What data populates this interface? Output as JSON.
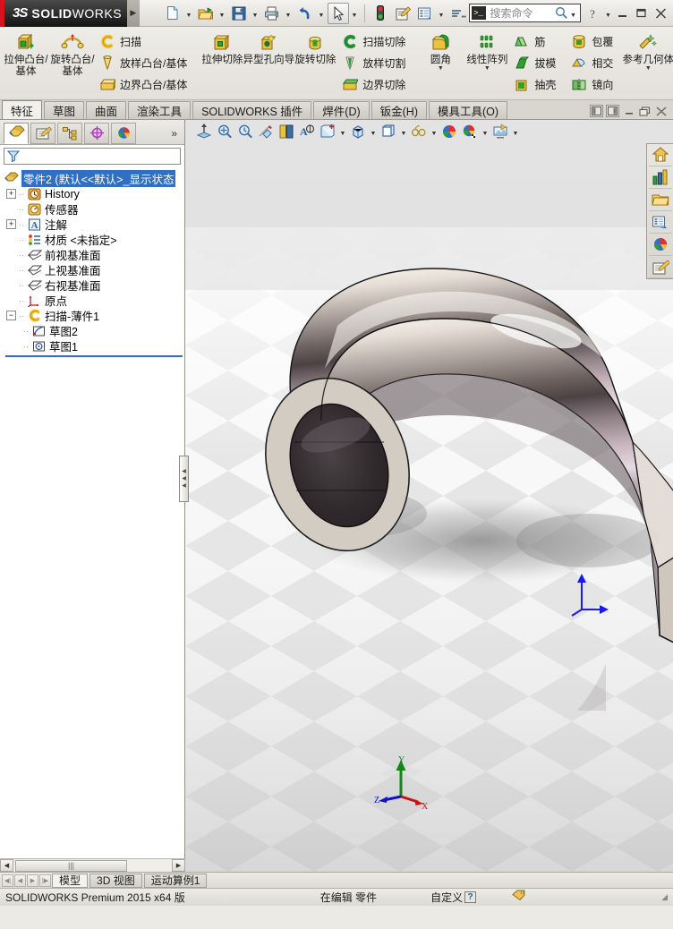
{
  "app": {
    "brand_ds": "3S",
    "brand_solid": "SOLID",
    "brand_works": "WORKS",
    "brand_red": "#d8121c"
  },
  "titlebar": {
    "tools": [
      {
        "name": "new-document",
        "label": "新建"
      },
      {
        "name": "open-document",
        "label": "打开"
      },
      {
        "name": "save-document",
        "label": "保存"
      },
      {
        "name": "print-document",
        "label": "打印"
      },
      {
        "name": "undo",
        "label": "撤消"
      },
      {
        "name": "select",
        "label": "选择"
      },
      {
        "name": "rebuild",
        "label": "重建模型"
      },
      {
        "name": "file-properties",
        "label": "文件属性"
      },
      {
        "name": "options",
        "label": "选项"
      },
      {
        "name": "toolbar-overflow",
        "label": "更多"
      }
    ],
    "search_placeholder": "搜索命令",
    "help_label": "帮助",
    "minimize_label": "最小化",
    "restore_label": "还原",
    "close_label": "关闭"
  },
  "ribbon": {
    "groups": [
      {
        "big": [
          {
            "label": "拉伸凸台/基体",
            "name": "extruded-boss-base",
            "dropdown": false
          },
          {
            "label": "旋转凸台/基体",
            "name": "revolved-boss-base",
            "dropdown": false
          }
        ],
        "small": [
          {
            "label": "扫描",
            "name": "swept-boss-base"
          },
          {
            "label": "放样凸台/基体",
            "name": "lofted-boss-base"
          },
          {
            "label": "边界凸台/基体",
            "name": "boundary-boss-base"
          }
        ]
      },
      {
        "big": [
          {
            "label": "拉伸切除",
            "name": "extruded-cut",
            "dropdown": false
          },
          {
            "label": "异型孔向导",
            "name": "hole-wizard",
            "dropdown": false
          },
          {
            "label": "旋转切除",
            "name": "revolved-cut",
            "dropdown": false
          }
        ],
        "small": [
          {
            "label": "扫描切除",
            "name": "swept-cut"
          },
          {
            "label": "放样切割",
            "name": "lofted-cut"
          },
          {
            "label": "边界切除",
            "name": "boundary-cut"
          }
        ]
      },
      {
        "big": [
          {
            "label": "圆角",
            "name": "fillet",
            "dropdown": true
          },
          {
            "label": "线性阵列",
            "name": "linear-pattern",
            "dropdown": true
          }
        ],
        "small": [
          {
            "label": "筋",
            "name": "rib"
          },
          {
            "label": "拔模",
            "name": "draft"
          },
          {
            "label": "抽壳",
            "name": "shell"
          }
        ]
      },
      {
        "big": [],
        "small": [
          {
            "label": "包覆",
            "name": "wrap"
          },
          {
            "label": "相交",
            "name": "intersect"
          },
          {
            "label": "镜向",
            "name": "mirror"
          }
        ]
      },
      {
        "big": [
          {
            "label": "参考几何体",
            "name": "reference-geometry",
            "dropdown": true
          }
        ],
        "small": []
      }
    ],
    "overflow": "»"
  },
  "tabs": {
    "items": [
      {
        "label": "特征",
        "name": "tab-features",
        "active": true
      },
      {
        "label": "草图",
        "name": "tab-sketch",
        "active": false
      },
      {
        "label": "曲面",
        "name": "tab-surfaces",
        "active": false
      },
      {
        "label": "渲染工具",
        "name": "tab-render-tools",
        "active": false
      },
      {
        "label": "SOLIDWORKS 插件",
        "name": "tab-solidworks-addins",
        "active": false
      },
      {
        "label": "焊件(D)",
        "name": "tab-weldments",
        "active": false
      },
      {
        "label": "钣金(H)",
        "name": "tab-sheet-metal",
        "active": false
      },
      {
        "label": "模具工具(O)",
        "name": "tab-mold-tools",
        "active": false
      }
    ],
    "doc_controls": [
      {
        "name": "collapse-left-panel",
        "glyph": "◧"
      },
      {
        "name": "collapse-right-panel",
        "glyph": "◨"
      },
      {
        "name": "doc-minimize",
        "glyph": "—"
      },
      {
        "name": "doc-restore",
        "glyph": "❐"
      },
      {
        "name": "doc-close",
        "glyph": "✕"
      }
    ]
  },
  "feature_manager": {
    "panel_tabs": [
      {
        "name": "feature-manager-tab",
        "active": true
      },
      {
        "name": "property-manager-tab",
        "active": false
      },
      {
        "name": "configuration-manager-tab",
        "active": false
      },
      {
        "name": "dimxpert-manager-tab",
        "active": false
      },
      {
        "name": "display-manager-tab",
        "active": false
      }
    ],
    "overflow": "»",
    "filter_placeholder": "",
    "tree": [
      {
        "label": "零件2  (默认<<默认>_显示状态",
        "name": "tree-part-root",
        "icon": "part-icon",
        "level": 0,
        "expand": "",
        "selected": true
      },
      {
        "label": "History",
        "name": "tree-history",
        "icon": "history-icon",
        "level": 1,
        "expand": "+",
        "selected": false
      },
      {
        "label": "传感器",
        "name": "tree-sensors",
        "icon": "sensors-icon",
        "level": 1,
        "expand": "",
        "selected": false
      },
      {
        "label": "注解",
        "name": "tree-annotations",
        "icon": "annotations-icon",
        "level": 1,
        "expand": "+",
        "selected": false
      },
      {
        "label": "材质 <未指定>",
        "name": "tree-material",
        "icon": "material-icon",
        "level": 1,
        "expand": "",
        "selected": false
      },
      {
        "label": "前视基准面",
        "name": "tree-front-plane",
        "icon": "plane-icon",
        "level": 1,
        "expand": "",
        "selected": false
      },
      {
        "label": "上视基准面",
        "name": "tree-top-plane",
        "icon": "plane-icon",
        "level": 1,
        "expand": "",
        "selected": false
      },
      {
        "label": "右视基准面",
        "name": "tree-right-plane",
        "icon": "plane-icon",
        "level": 1,
        "expand": "",
        "selected": false
      },
      {
        "label": "原点",
        "name": "tree-origin",
        "icon": "origin-icon",
        "level": 1,
        "expand": "",
        "selected": false
      },
      {
        "label": "扫描-薄件1",
        "name": "tree-sweep-thin1",
        "icon": "sweep-icon",
        "level": 1,
        "expand": "−",
        "selected": false
      },
      {
        "label": "草图2",
        "name": "tree-sketch2",
        "icon": "sketch-path-icon",
        "level": 2,
        "expand": "",
        "selected": false
      },
      {
        "label": "草图1",
        "name": "tree-sketch1",
        "icon": "sketch-profile-icon",
        "level": 2,
        "expand": "",
        "selected": false
      }
    ],
    "hscroll": {
      "left_glyph": "◀",
      "right_glyph": "▶",
      "thumb_glyph": "|||"
    }
  },
  "view_toolbar": {
    "buttons": [
      {
        "name": "zoom-to-fit-icon",
        "caret": false
      },
      {
        "name": "zoom-to-area-icon",
        "caret": false
      },
      {
        "name": "previous-view-icon",
        "caret": false
      },
      {
        "name": "section-view-icon",
        "caret": false
      },
      {
        "name": "view-orientation-book-icon",
        "caret": false
      },
      {
        "name": "hide-show-items-icon",
        "caret": false
      },
      {
        "name": "view-orientation-icon",
        "caret": true
      },
      {
        "name": "display-style-cube-icon",
        "caret": true
      },
      {
        "name": "display-style-icon",
        "caret": true
      },
      {
        "name": "edit-appearance-glasses-icon",
        "caret": true
      },
      {
        "name": "apply-scene-icon",
        "caret": false
      },
      {
        "name": "view-settings-icon",
        "caret": true
      },
      {
        "name": "render-tools-icon",
        "caret": true
      }
    ]
  },
  "task_pane": {
    "buttons": [
      {
        "name": "solidworks-resources-home-icon"
      },
      {
        "name": "design-library-icon"
      },
      {
        "name": "file-explorer-icon"
      },
      {
        "name": "view-palette-icon"
      },
      {
        "name": "appearances-scenes-icon"
      },
      {
        "name": "custom-properties-icon"
      }
    ]
  },
  "model": {
    "part_description": "扫描薄壁件 — 圆形到六角形截面的弯曲管件",
    "material_appearance": "抛光铬",
    "triad_axes": [
      {
        "label": "Y",
        "color": "#118811"
      },
      {
        "label": "X",
        "color": "#cc1111"
      },
      {
        "label": "Z",
        "color": "#1111cc"
      }
    ],
    "origin_color": "#1a1aee"
  },
  "bottom": {
    "nav": [
      {
        "name": "nav-first",
        "glyph": "◀|"
      },
      {
        "name": "nav-prev",
        "glyph": "◀"
      },
      {
        "name": "nav-next",
        "glyph": "▶"
      },
      {
        "name": "nav-last",
        "glyph": "|▶"
      }
    ],
    "tabs": [
      {
        "label": "模型",
        "name": "bottom-tab-model",
        "active": true
      },
      {
        "label": "3D 视图",
        "name": "bottom-tab-3d-views",
        "active": false
      },
      {
        "label": "运动算例1",
        "name": "bottom-tab-motion-study-1",
        "active": false
      }
    ]
  },
  "statusbar": {
    "version": "SOLIDWORKS Premium 2015 x64 版",
    "edit_state": "在编辑 零件",
    "custom_label": "自定义",
    "help_glyph": "?",
    "tag_icon": "tag-icon",
    "grip_glyph": "◢"
  }
}
